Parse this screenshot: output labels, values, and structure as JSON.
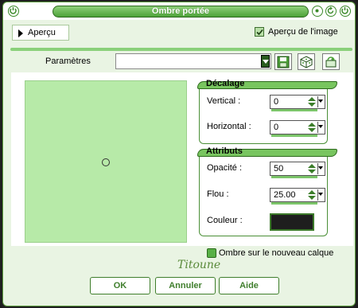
{
  "window": {
    "title": "Ombre portée"
  },
  "preview": {
    "toggle_label": "Aperçu",
    "image_preview_label": "Aperçu de l'image",
    "image_preview_checked": true
  },
  "presets": {
    "label": "Paramètres",
    "value": ""
  },
  "offset_group": {
    "title": "Décalage",
    "vertical_label": "Vertical :",
    "vertical_value": "0",
    "horizontal_label": "Horizontal :",
    "horizontal_value": "0"
  },
  "attributes_group": {
    "title": "Attributs",
    "opacity_label": "Opacité :",
    "opacity_value": "50",
    "blur_label": "Flou :",
    "blur_value": "25.00",
    "color_label": "Couleur :",
    "color_value": "#1e1e1e"
  },
  "layer_option": {
    "label": "Ombre sur le nouveau calque",
    "checked": true
  },
  "signature": "Titoune",
  "buttons": {
    "ok": "OK",
    "cancel": "Annuler",
    "help": "Aide"
  },
  "colors": {
    "accent": "#4ea23a",
    "preview_bg": "#b7eaa8",
    "frame_bg": "#e9f4e3"
  }
}
